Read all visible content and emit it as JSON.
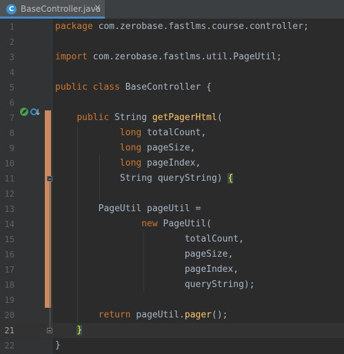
{
  "tab": {
    "label": "BaseController.java",
    "icon_letter": "C",
    "close": "×"
  },
  "gutter": {
    "line_numbers": [
      "1",
      "2",
      "3",
      "4",
      "5",
      "6",
      "7",
      "8",
      "9",
      "10",
      "11",
      "12",
      "13",
      "14",
      "15",
      "16",
      "17",
      "18",
      "19",
      "20",
      "21",
      "22"
    ],
    "current_line": "21"
  },
  "code": {
    "l1": {
      "kw": "package",
      "rest": " com.zerobase.fastlms.course.controller;"
    },
    "l3": {
      "kw": "import",
      "rest": " com.zerobase.fastlms.util.PageUtil;"
    },
    "l5": {
      "kw": "public class",
      "rest": " BaseController {"
    },
    "l7": {
      "indent": "    ",
      "kw": "public",
      "mid": " String ",
      "fn": "getPagerHtml",
      "rest": "("
    },
    "l8": {
      "indent": "            ",
      "kw": "long",
      "rest": " totalCount,"
    },
    "l9": {
      "indent": "            ",
      "kw": "long",
      "rest": " pageSize,"
    },
    "l10": {
      "indent": "            ",
      "kw": "long",
      "rest": " pageIndex,"
    },
    "l11": {
      "indent": "            ",
      "text": "String queryString) ",
      "brace": "{"
    },
    "l13": {
      "text": "        PageUtil pageUtil ="
    },
    "l14": {
      "indent": "                ",
      "kw": "new",
      "rest": " PageUtil("
    },
    "l15": {
      "text": "                        totalCount,"
    },
    "l16": {
      "text": "                        pageSize,"
    },
    "l17": {
      "text": "                        pageIndex,"
    },
    "l18": {
      "text": "                        queryString);"
    },
    "l20": {
      "indent": "        ",
      "kw": "return",
      "mid": " pageUtil.",
      "fn": "pager",
      "rest": "();"
    },
    "l21": {
      "indent": "    ",
      "brace": "}"
    },
    "l22": {
      "text": "}"
    }
  },
  "colors": {
    "keyword": "#cc7832",
    "method": "#ffc66d",
    "default_text": "#a9b7c6",
    "change_marker": "#d0895d",
    "tab_accent": "#4a88c7"
  },
  "icons": [
    "java-class-file-icon",
    "close-icon",
    "spring-bean-icon",
    "implementation-down-icon",
    "fold-icon"
  ]
}
